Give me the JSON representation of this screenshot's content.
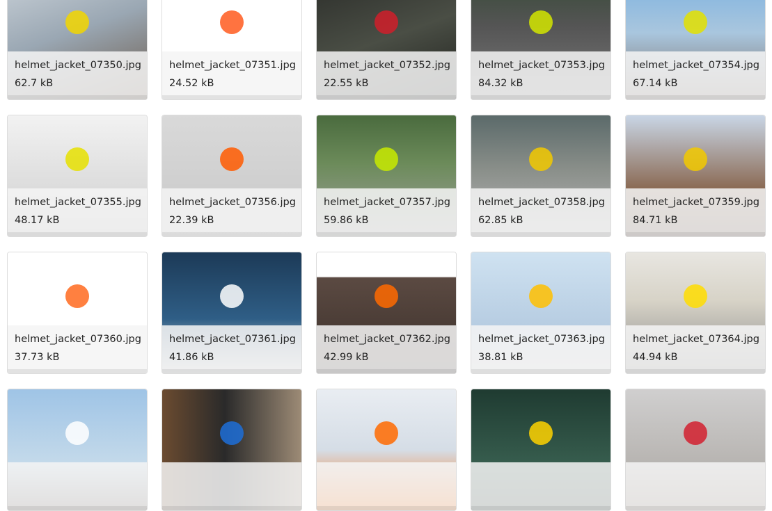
{
  "files": [
    {
      "name": "helmet_jacket_07350.jpg",
      "size": "62.7 kB",
      "icon": "image-thumbnail-icon",
      "bg": "linear-gradient(160deg,#c7cfd6 0%,#9aa7b3 45%,#6b5a4b 100%)",
      "accent": "#f2d600"
    },
    {
      "name": "helmet_jacket_07351.jpg",
      "size": "24.52 kB",
      "icon": "image-thumbnail-icon",
      "bg": "linear-gradient(180deg,#ffffff 0%,#ffffff 100%)",
      "accent": "#ff5a1f"
    },
    {
      "name": "helmet_jacket_07352.jpg",
      "size": "22.55 kB",
      "icon": "image-thumbnail-icon",
      "bg": "linear-gradient(160deg,#2d2f2b 0%,#4a4e45 50%,#1f211d 100%)",
      "accent": "#d01f2a"
    },
    {
      "name": "helmet_jacket_07353.jpg",
      "size": "84.32 kB",
      "icon": "image-thumbnail-icon",
      "bg": "linear-gradient(180deg,#3a4b3a 0%,#555 40%,#7a7a7a 100%)",
      "accent": "#d4e600"
    },
    {
      "name": "helmet_jacket_07354.jpg",
      "size": "67.14 kB",
      "icon": "image-thumbnail-icon",
      "bg": "linear-gradient(180deg,#7fb3e0 0%,#a9c6de 45%,#7a6d66 100%)",
      "accent": "#e3e000"
    },
    {
      "name": "helmet_jacket_07355.jpg",
      "size": "48.17 kB",
      "icon": "image-thumbnail-icon",
      "bg": "linear-gradient(180deg,#f2f2f2 0%,#dcdcdc 60%,#bdbdbd 100%)",
      "accent": "#e6e000"
    },
    {
      "name": "helmet_jacket_07356.jpg",
      "size": "22.39 kB",
      "icon": "image-thumbnail-icon",
      "bg": "linear-gradient(180deg,#d9d9d9 0%,#c8c8c8 100%)",
      "accent": "#ff5a00"
    },
    {
      "name": "helmet_jacket_07357.jpg",
      "size": "59.86 kB",
      "icon": "image-thumbnail-icon",
      "bg": "linear-gradient(180deg,#4a6b3e 0%,#6c8b5a 40%,#a0a0a0 100%)",
      "accent": "#c8ea00"
    },
    {
      "name": "helmet_jacket_07358.jpg",
      "size": "62.85 kB",
      "icon": "image-thumbnail-icon",
      "bg": "linear-gradient(180deg,#5b6a6a 0%,#8a8f8a 45%,#b7b7b7 100%)",
      "accent": "#f2c900"
    },
    {
      "name": "helmet_jacket_07359.jpg",
      "size": "84.71 kB",
      "icon": "image-thumbnail-icon",
      "bg": "linear-gradient(180deg,#c9d6e6 0%,#8b6b55 60%,#5a4334 100%)",
      "accent": "#f2c900"
    },
    {
      "name": "helmet_jacket_07360.jpg",
      "size": "37.73 kB",
      "icon": "image-thumbnail-icon",
      "bg": "linear-gradient(180deg,#ffffff 0%,#ffffff 100%)",
      "accent": "#ff6a1f"
    },
    {
      "name": "helmet_jacket_07361.jpg",
      "size": "41.86 kB",
      "icon": "image-thumbnail-icon",
      "bg": "linear-gradient(180deg,#1c3a57 0%,#2f5e86 55%,#d9d9d9 100%)",
      "accent": "#ffffff"
    },
    {
      "name": "helmet_jacket_07362.jpg",
      "size": "42.99 kB",
      "icon": "image-thumbnail-icon",
      "bg": "linear-gradient(180deg,#ffffff 0%,#ffffff 20%,#5b4a42 21%,#3b2f2a 100%)",
      "accent": "#ff6a00"
    },
    {
      "name": "helmet_jacket_07363.jpg",
      "size": "38.81 kB",
      "icon": "image-thumbnail-icon",
      "bg": "linear-gradient(180deg,#cfe2f1 0%,#b7cde2 60%,#d9d9d9 100%)",
      "accent": "#ffbf00"
    },
    {
      "name": "helmet_jacket_07364.jpg",
      "size": "44.94 kB",
      "icon": "image-thumbnail-icon",
      "bg": "linear-gradient(180deg,#e8e6e1 0%,#d7d3c7 40%,#8a8a8a 100%)",
      "accent": "#ffdd00"
    },
    {
      "name": "",
      "size": "",
      "icon": "image-thumbnail-icon",
      "bg": "linear-gradient(180deg,#9fc4e6 0%,#c3d9ea 60%,#6a5f58 100%)",
      "accent": "#ffffff"
    },
    {
      "name": "",
      "size": "",
      "icon": "image-thumbnail-icon",
      "bg": "linear-gradient(90deg,#6b4b30 0%,#2a2a2a 45%,#9d8b76 100%)",
      "accent": "#1d6fd8"
    },
    {
      "name": "",
      "size": "",
      "icon": "image-thumbnail-icon",
      "bg": "linear-gradient(180deg,#e9edf2 0%,#d5dde6 50%,#ff6a00 100%)",
      "accent": "#ff6a00"
    },
    {
      "name": "",
      "size": "",
      "icon": "image-thumbnail-icon",
      "bg": "linear-gradient(180deg,#1f3b31 0%,#365c4d 60%,#20332c 100%)",
      "accent": "#ffd200"
    },
    {
      "name": "",
      "size": "",
      "icon": "image-thumbnail-icon",
      "bg": "linear-gradient(180deg,#d0cfcf 0%,#b8b5b2 60%,#8a7b6e 100%)",
      "accent": "#d2202f"
    }
  ]
}
